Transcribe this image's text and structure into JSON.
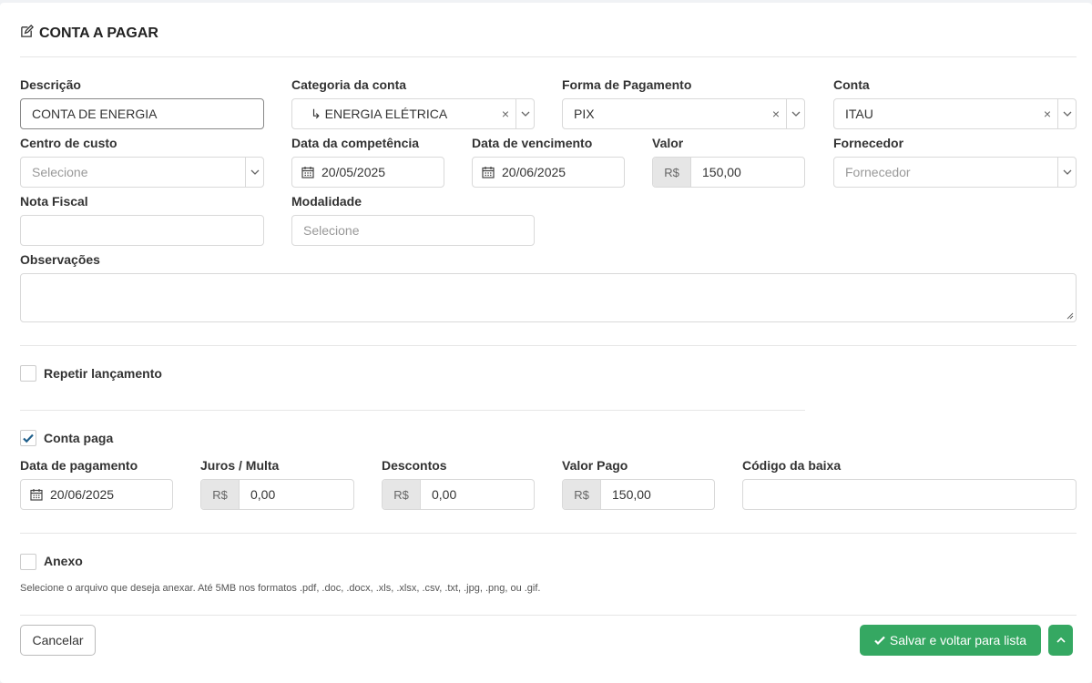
{
  "header": {
    "title": "CONTA A PAGAR"
  },
  "labels": {
    "descricao": "Descrição",
    "categoria": "Categoria da conta",
    "forma_pagamento": "Forma de Pagamento",
    "conta": "Conta",
    "centro_custo": "Centro de custo",
    "data_competencia": "Data da competência",
    "data_vencimento": "Data de vencimento",
    "valor": "Valor",
    "fornecedor": "Fornecedor",
    "nota_fiscal": "Nota Fiscal",
    "modalidade": "Modalidade",
    "observacoes": "Observações",
    "data_pagamento": "Data de pagamento",
    "juros_multa": "Juros / Multa",
    "descontos": "Descontos",
    "valor_pago": "Valor Pago",
    "codigo_baixa": "Código da baixa"
  },
  "fields": {
    "descricao": "CONTA DE ENERGIA",
    "categoria": "↳ ENERGIA ELÉTRICA",
    "forma_pagamento": "PIX",
    "conta": "ITAU",
    "centro_custo_placeholder": "Selecione",
    "data_competencia": "20/05/2025",
    "data_vencimento": "20/06/2025",
    "currency": "R$",
    "valor": "150,00",
    "fornecedor_placeholder": "Fornecedor",
    "nota_fiscal": "",
    "modalidade_placeholder": "Selecione",
    "observacoes": "",
    "data_pagamento": "20/06/2025",
    "juros_multa": "0,00",
    "descontos": "0,00",
    "valor_pago": "150,00",
    "codigo_baixa": ""
  },
  "clear_symbol": "×",
  "checkboxes": {
    "repetir": {
      "label": "Repetir lançamento",
      "checked": false
    },
    "conta_paga": {
      "label": "Conta paga",
      "checked": true
    },
    "anexo": {
      "label": "Anexo",
      "checked": false
    }
  },
  "anexo_help": "Selecione o arquivo que deseja anexar. Até 5MB nos formatos .pdf, .doc, .docx, .xls, .xlsx, .csv, .txt, .jpg, .png, ou .gif.",
  "footer": {
    "cancel_label": "Cancelar",
    "save_label": "Salvar e voltar para lista"
  },
  "colors": {
    "primary_green": "#35a862",
    "checkbox_check": "#1f5f8b"
  }
}
